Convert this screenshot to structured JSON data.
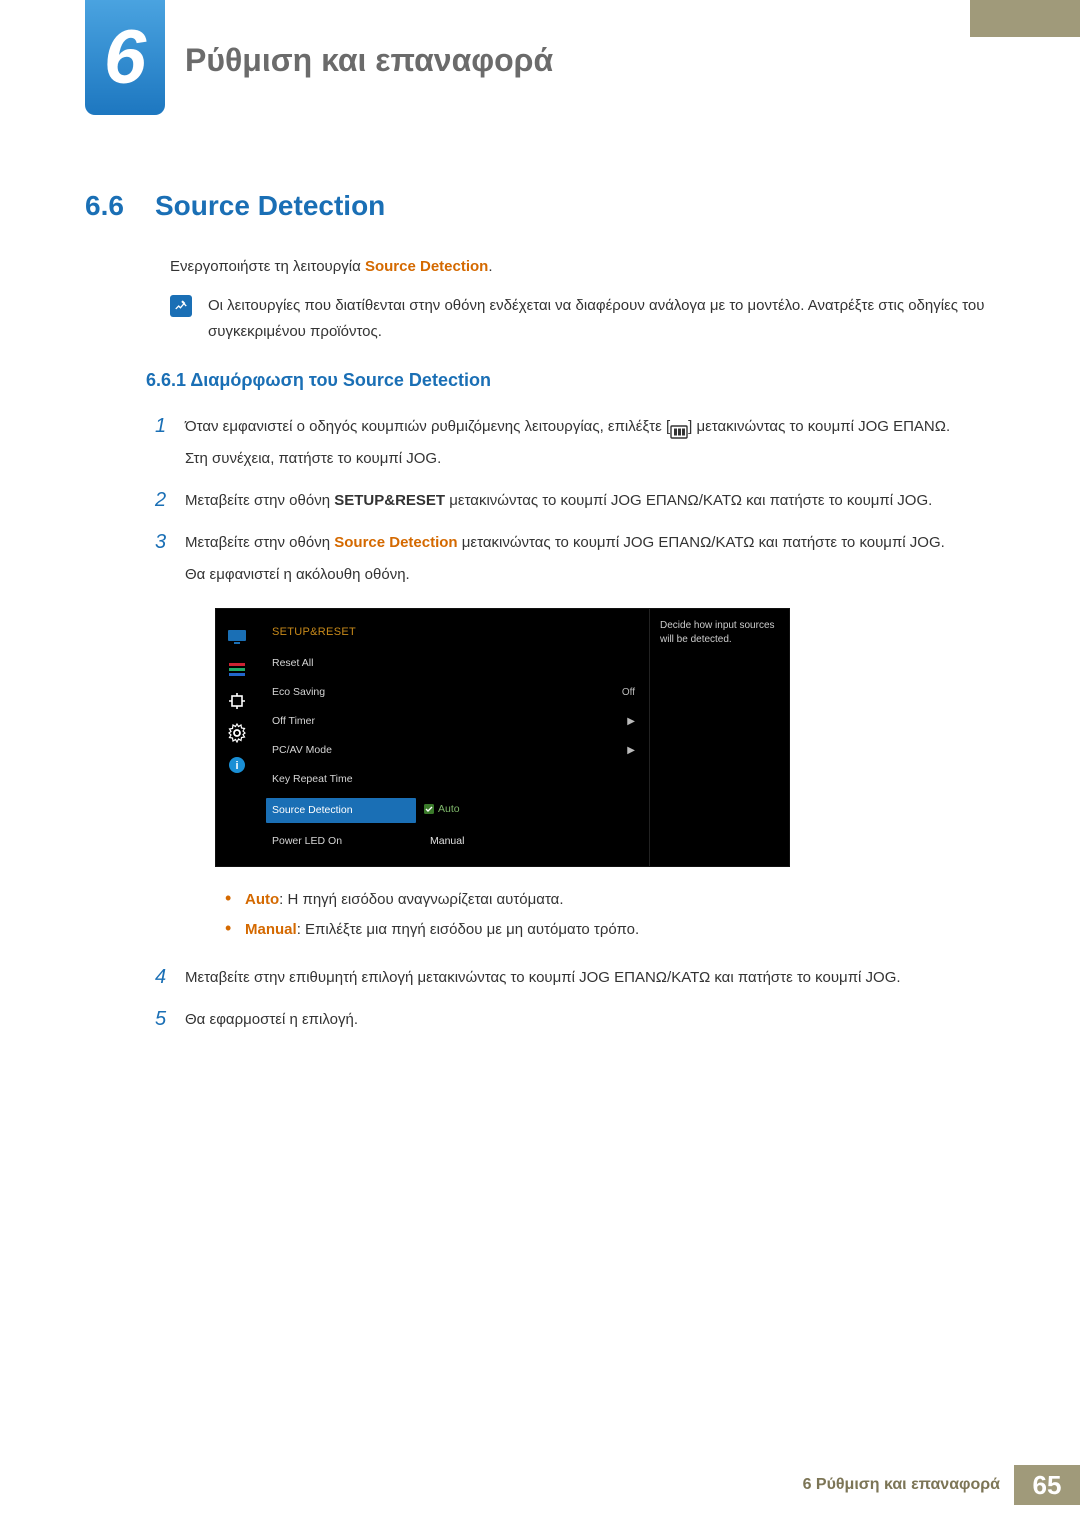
{
  "chapter": {
    "number": "6",
    "title": "Ρύθμιση και επαναφορά"
  },
  "section": {
    "number": "6.6",
    "title": "Source Detection"
  },
  "intro": {
    "prefix": "Ενεργοποιήστε τη λειτουργία ",
    "highlight": "Source Detection",
    "suffix": "."
  },
  "note": "Οι λειτουργίες που διατίθενται στην οθόνη ενδέχεται να διαφέρουν ανάλογα με το μοντέλο. Ανατρέξτε στις οδηγίες του συγκεκριμένου προϊόντος.",
  "subsection": "6.6.1   Διαμόρφωση του Source Detection",
  "steps": {
    "s1": {
      "num": "1",
      "p1a": "Όταν εμφανιστεί ο οδηγός κουμπιών ρυθμιζόμενης λειτουργίας, επιλέξτε [",
      "p1b": "] μετακινώντας το κουμπί JOG ΕΠΑΝΩ.",
      "p2": "Στη συνέχεια, πατήστε το κουμπί JOG."
    },
    "s2": {
      "num": "2",
      "a": "Μεταβείτε στην οθόνη ",
      "b": "SETUP&RESET",
      "c": " μετακινώντας το κουμπί JOG ΕΠΑΝΩ/ΚΑΤΩ και πατήστε το κουμπί JOG."
    },
    "s3": {
      "num": "3",
      "a": "Μεταβείτε στην οθόνη ",
      "b": "Source Detection",
      "c": " μετακινώντας το κουμπί JOG ΕΠΑΝΩ/ΚΑΤΩ και πατήστε το κουμπί JOG.",
      "d": "Θα εμφανιστεί η ακόλουθη οθόνη."
    },
    "s4": {
      "num": "4",
      "text": "Μεταβείτε στην επιθυμητή επιλογή μετακινώντας το κουμπί JOG ΕΠΑΝΩ/ΚΑΤΩ και πατήστε το κουμπί JOG."
    },
    "s5": {
      "num": "5",
      "text": "Θα εφαρμοστεί η επιλογή."
    }
  },
  "osd": {
    "title": "SETUP&RESET",
    "rows": {
      "resetall": "Reset All",
      "eco": "Eco Saving",
      "eco_val": "Off",
      "offtimer": "Off Timer",
      "pcav": "PC/AV Mode",
      "keyrepeat": "Key Repeat Time",
      "srcdet": "Source Detection",
      "auto": "Auto",
      "manual": "Manual",
      "powerled": "Power LED On"
    },
    "desc": "Decide how input sources will be detected.",
    "arrow": "▶"
  },
  "bullets": {
    "auto_label": "Auto",
    "auto_text": ": Η πηγή εισόδου αναγνωρίζεται αυτόματα.",
    "manual_label": "Manual",
    "manual_text": ": Επιλέξτε μια πηγή εισόδου με μη αυτόματο τρόπο."
  },
  "footer": {
    "text": "6 Ρύθμιση και επαναφορά",
    "page": "65"
  }
}
